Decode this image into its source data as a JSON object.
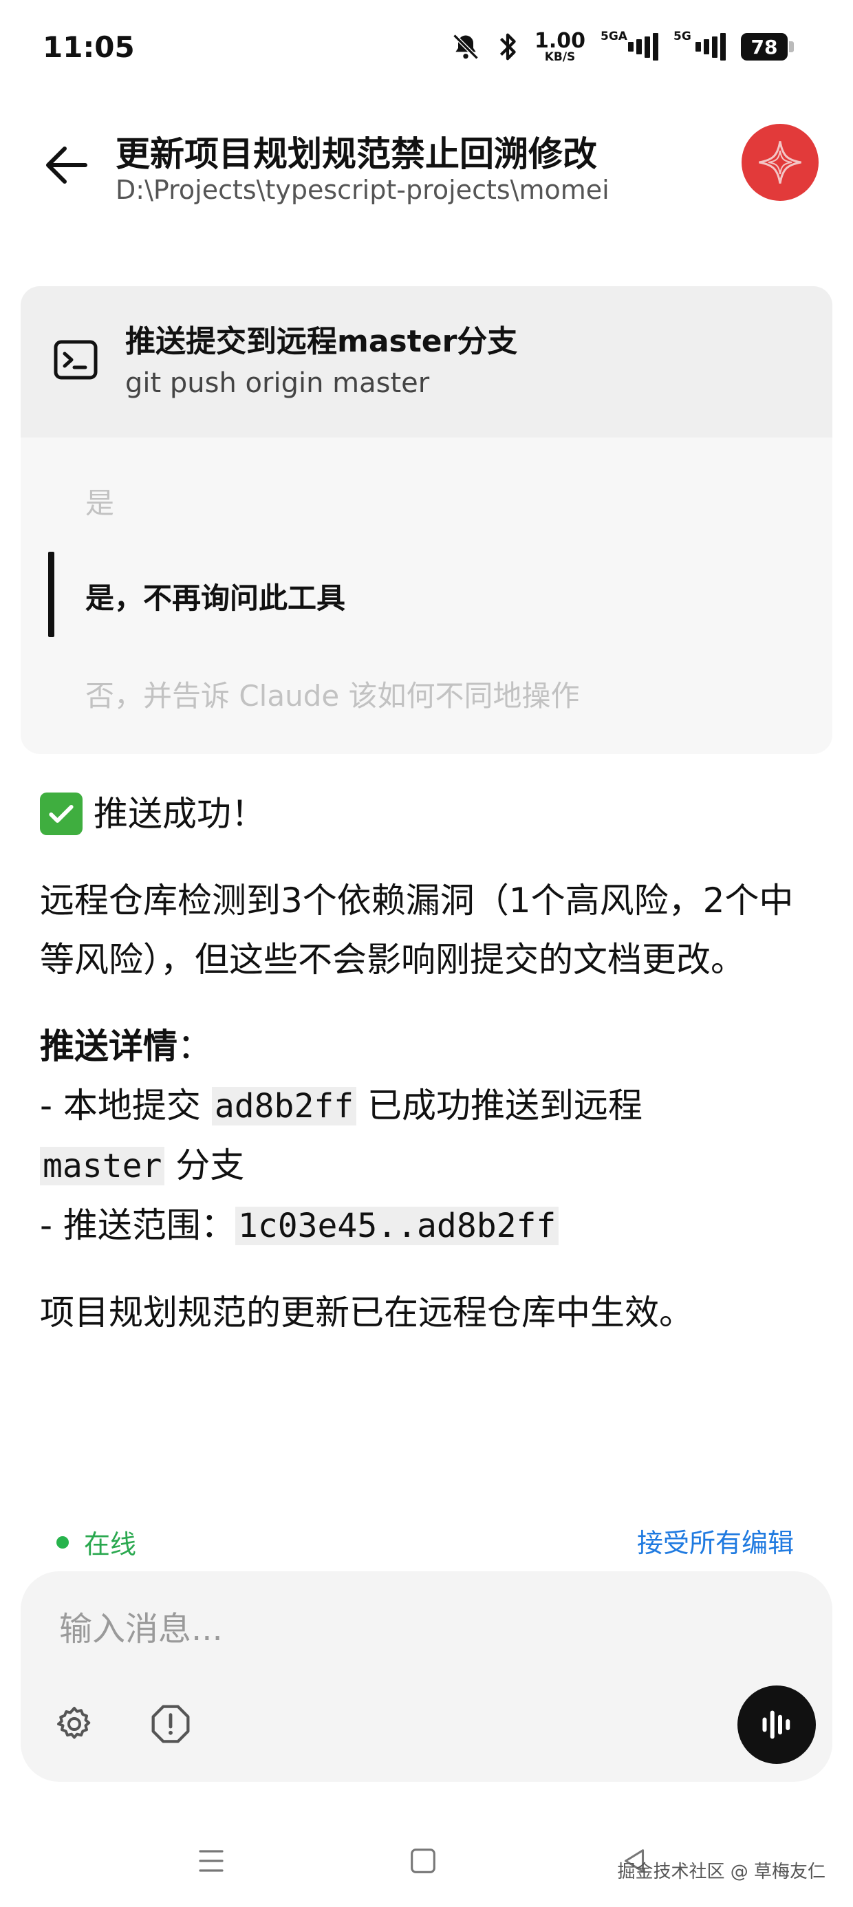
{
  "status_bar": {
    "time": "11:05",
    "net_speed_value": "1.00",
    "net_speed_unit": "KB/S",
    "signal_1_label": "5GA",
    "signal_2_label": "5G",
    "battery": "78",
    "icons": [
      "mute-bell-icon",
      "bluetooth-icon"
    ]
  },
  "header": {
    "title": "更新项目规划规范禁止回溯修改",
    "path": "D:\\Projects\\typescript-projects\\momei",
    "avatar_color": "#e23a3a"
  },
  "permission": {
    "title": "推送提交到远程master分支",
    "command": "git push origin master",
    "options": [
      "是",
      "是，不再询问此工具",
      "否，并告诉 Claude 该如何不同地操作"
    ],
    "selected_index": 1
  },
  "message": {
    "success_text": "推送成功！",
    "para1": "远程仓库检测到3个依赖漏洞（1个高风险，2个中等风险），但这些不会影响刚提交的文档更改。",
    "details_title": "推送详情",
    "details_colon": "：",
    "line1_prefix": "- 本地提交 ",
    "line1_code": "ad8b2ff",
    "line1_mid": " 已成功推送到远程",
    "line1_code2": "master",
    "line1_suffix": " 分支",
    "line2_prefix": "- 推送范围：",
    "line2_code": "1c03e45..ad8b2ff",
    "para_final": "项目规划规范的更新已在远程仓库中生效。"
  },
  "footer": {
    "online_label": "在线",
    "accept_all_label": "接受所有编辑",
    "online_color": "#27b34c",
    "accent_color": "#1f7ae0"
  },
  "input": {
    "placeholder": "输入消息..."
  },
  "watermark": "掘金技术社区 @ 草梅友仁"
}
